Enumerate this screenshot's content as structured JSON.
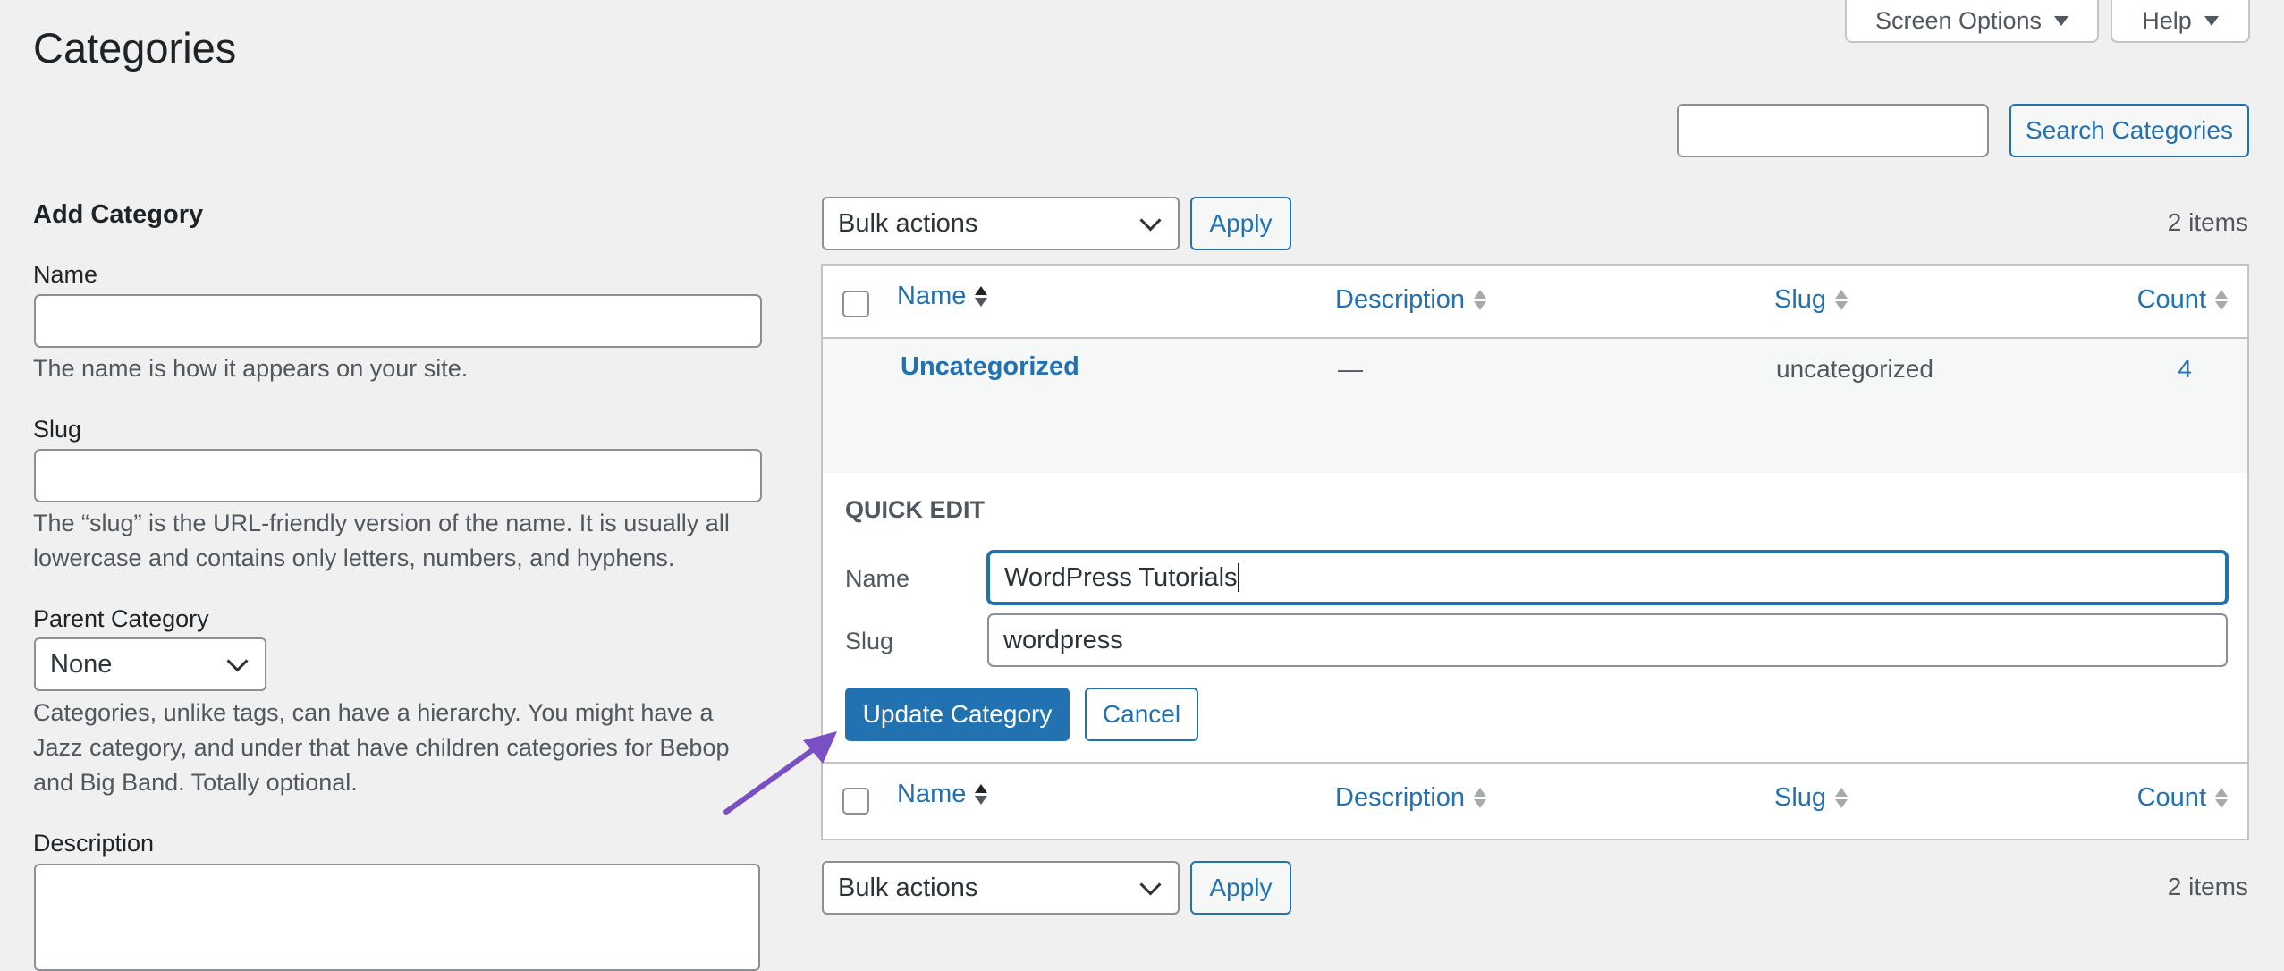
{
  "page": {
    "title": "Categories"
  },
  "top_tabs": {
    "screen_options": "Screen Options",
    "help": "Help"
  },
  "search": {
    "value": "",
    "button": "Search Categories"
  },
  "add_form": {
    "heading": "Add Category",
    "name_label": "Name",
    "name_value": "",
    "name_help": "The name is how it appears on your site.",
    "slug_label": "Slug",
    "slug_value": "",
    "slug_help_line1": "The “slug” is the URL-friendly version of the name. It is usually all",
    "slug_help_line2": "lowercase and contains only letters, numbers, and hyphens.",
    "parent_label": "Parent Category",
    "parent_selected": "None",
    "parent_help_line1": "Categories, unlike tags, can have a hierarchy. You might have a",
    "parent_help_line2": "Jazz category, and under that have children categories for Bebop",
    "parent_help_line3": "and Big Band. Totally optional.",
    "description_label": "Description"
  },
  "tablenav": {
    "bulk_actions": "Bulk actions",
    "apply": "Apply",
    "items_count": "2 items"
  },
  "columns": {
    "name": "Name",
    "description": "Description",
    "slug": "Slug",
    "count": "Count"
  },
  "rows": [
    {
      "name": "Uncategorized",
      "description": "—",
      "slug": "uncategorized",
      "count": "4"
    }
  ],
  "quick_edit": {
    "heading": "QUICK EDIT",
    "name_label": "Name",
    "name_value": "WordPress Tutorials",
    "slug_label": "Slug",
    "slug_value": "wordpress",
    "update_button": "Update Category",
    "cancel_button": "Cancel"
  },
  "colors": {
    "accent": "#2271b1",
    "arrow": "#7b4fc4",
    "background": "#f0f0f1"
  }
}
